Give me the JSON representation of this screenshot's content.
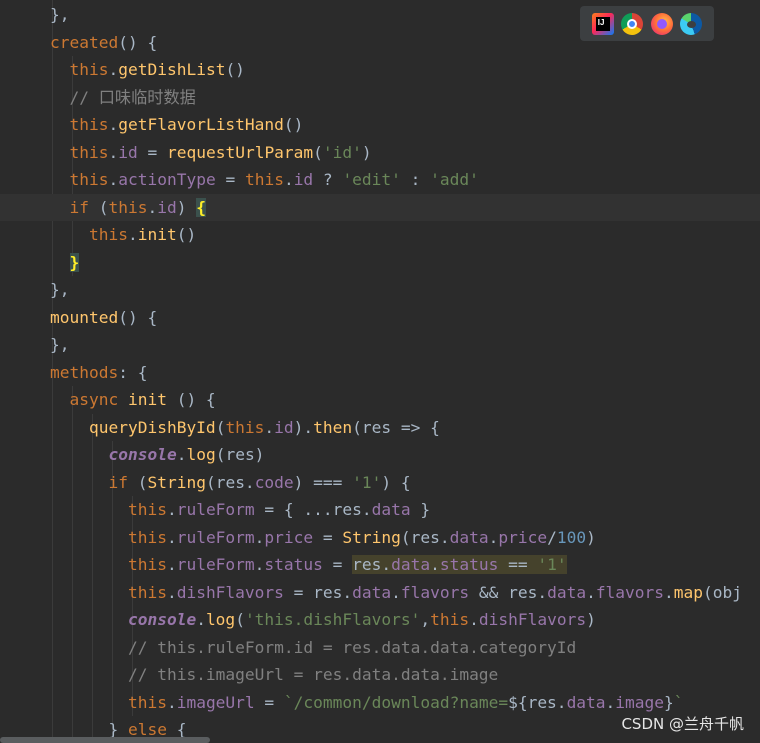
{
  "browser_bar": {
    "icons": [
      "intellij-icon",
      "chrome-icon",
      "firefox-icon",
      "edge-icon"
    ],
    "intellij_label": "IJ"
  },
  "watermark": "CSDN @兰舟千帆",
  "lines": [
    [
      {
        "t": "},",
        "c": "def"
      }
    ],
    [
      {
        "t": "created",
        "c": "kw"
      },
      {
        "t": "() {",
        "c": "def"
      }
    ],
    [
      {
        "t": "  this",
        "c": "this"
      },
      {
        "t": ".",
        "c": "def"
      },
      {
        "t": "getDishList",
        "c": "fn"
      },
      {
        "t": "()",
        "c": "def"
      }
    ],
    [
      {
        "t": "  // 口味临时数据",
        "c": "cmt"
      }
    ],
    [
      {
        "t": "  this",
        "c": "this"
      },
      {
        "t": ".",
        "c": "def"
      },
      {
        "t": "getFlavorListHand",
        "c": "fn"
      },
      {
        "t": "()",
        "c": "def"
      }
    ],
    [
      {
        "t": "  this",
        "c": "this"
      },
      {
        "t": ".",
        "c": "def"
      },
      {
        "t": "id",
        "c": "fld"
      },
      {
        "t": " = ",
        "c": "def"
      },
      {
        "t": "requestUrlParam",
        "c": "fn"
      },
      {
        "t": "(",
        "c": "def"
      },
      {
        "t": "'id'",
        "c": "str"
      },
      {
        "t": ")",
        "c": "def"
      }
    ],
    [
      {
        "t": "  this",
        "c": "this"
      },
      {
        "t": ".",
        "c": "def"
      },
      {
        "t": "actionType",
        "c": "fld"
      },
      {
        "t": " = ",
        "c": "def"
      },
      {
        "t": "this",
        "c": "this"
      },
      {
        "t": ".",
        "c": "def"
      },
      {
        "t": "id",
        "c": "fld"
      },
      {
        "t": " ? ",
        "c": "def"
      },
      {
        "t": "'edit'",
        "c": "str"
      },
      {
        "t": " : ",
        "c": "def"
      },
      {
        "t": "'add'",
        "c": "str"
      }
    ],
    [
      {
        "t": "  if",
        "c": "kw"
      },
      {
        "t": " (",
        "c": "def"
      },
      {
        "t": "this",
        "c": "this"
      },
      {
        "t": ".",
        "c": "def"
      },
      {
        "t": "id",
        "c": "fld"
      },
      {
        "t": ") ",
        "c": "def"
      },
      {
        "t": "{",
        "c": "brace"
      }
    ],
    [
      {
        "t": "    this",
        "c": "this"
      },
      {
        "t": ".",
        "c": "def"
      },
      {
        "t": "init",
        "c": "fn"
      },
      {
        "t": "()",
        "c": "def"
      }
    ],
    [
      {
        "t": "  ",
        "c": "def"
      },
      {
        "t": "}",
        "c": "brace"
      }
    ],
    [
      {
        "t": "},",
        "c": "def"
      }
    ],
    [
      {
        "t": "mounted",
        "c": "fn"
      },
      {
        "t": "() {",
        "c": "def"
      }
    ],
    [
      {
        "t": "},",
        "c": "def"
      }
    ],
    [
      {
        "t": "methods",
        "c": "kw"
      },
      {
        "t": ": {",
        "c": "def"
      }
    ],
    [
      {
        "t": "  async ",
        "c": "kw"
      },
      {
        "t": "init",
        "c": "fn"
      },
      {
        "t": " () {",
        "c": "def"
      }
    ],
    [
      {
        "t": "    queryDishById",
        "c": "fn"
      },
      {
        "t": "(",
        "c": "def"
      },
      {
        "t": "this",
        "c": "this"
      },
      {
        "t": ".",
        "c": "def"
      },
      {
        "t": "id",
        "c": "fld"
      },
      {
        "t": ").",
        "c": "def"
      },
      {
        "t": "then",
        "c": "fn"
      },
      {
        "t": "(res => {",
        "c": "def"
      }
    ],
    [
      {
        "t": "      console",
        "c": "con"
      },
      {
        "t": ".",
        "c": "def"
      },
      {
        "t": "log",
        "c": "fn"
      },
      {
        "t": "(res)",
        "c": "def"
      }
    ],
    [
      {
        "t": "      if",
        "c": "kw"
      },
      {
        "t": " (",
        "c": "def"
      },
      {
        "t": "String",
        "c": "fn"
      },
      {
        "t": "(res.",
        "c": "def"
      },
      {
        "t": "code",
        "c": "fld"
      },
      {
        "t": ") === ",
        "c": "def"
      },
      {
        "t": "'1'",
        "c": "str"
      },
      {
        "t": ") {",
        "c": "def"
      }
    ],
    [
      {
        "t": "        this",
        "c": "this"
      },
      {
        "t": ".",
        "c": "def"
      },
      {
        "t": "ruleForm",
        "c": "fld"
      },
      {
        "t": " = { ...res.",
        "c": "def"
      },
      {
        "t": "data",
        "c": "fld"
      },
      {
        "t": " }",
        "c": "def"
      }
    ],
    [
      {
        "t": "        this",
        "c": "this"
      },
      {
        "t": ".",
        "c": "def"
      },
      {
        "t": "ruleForm",
        "c": "fld"
      },
      {
        "t": ".",
        "c": "def"
      },
      {
        "t": "price",
        "c": "fld"
      },
      {
        "t": " = ",
        "c": "def"
      },
      {
        "t": "String",
        "c": "fn"
      },
      {
        "t": "(res.",
        "c": "def"
      },
      {
        "t": "data",
        "c": "fld"
      },
      {
        "t": ".",
        "c": "def"
      },
      {
        "t": "price",
        "c": "fld"
      },
      {
        "t": "/",
        "c": "def"
      },
      {
        "t": "100",
        "c": "num"
      },
      {
        "t": ")",
        "c": "def"
      }
    ],
    [
      {
        "t": "        this",
        "c": "this"
      },
      {
        "t": ".",
        "c": "def"
      },
      {
        "t": "ruleForm",
        "c": "fld"
      },
      {
        "t": ".",
        "c": "def"
      },
      {
        "t": "status",
        "c": "fld"
      },
      {
        "t": " = ",
        "c": "def"
      },
      {
        "t": "res.",
        "c": "hl"
      },
      {
        "t": "data",
        "c": "hlfld"
      },
      {
        "t": ".",
        "c": "hl"
      },
      {
        "t": "status",
        "c": "hlfld"
      },
      {
        "t": " == ",
        "c": "hl"
      },
      {
        "t": "'1'",
        "c": "hlstr"
      }
    ],
    [
      {
        "t": "        this",
        "c": "this"
      },
      {
        "t": ".",
        "c": "def"
      },
      {
        "t": "dishFlavors",
        "c": "fld"
      },
      {
        "t": " = res.",
        "c": "def"
      },
      {
        "t": "data",
        "c": "fld"
      },
      {
        "t": ".",
        "c": "def"
      },
      {
        "t": "flavors",
        "c": "fld"
      },
      {
        "t": " && res.",
        "c": "def"
      },
      {
        "t": "data",
        "c": "fld"
      },
      {
        "t": ".",
        "c": "def"
      },
      {
        "t": "flavors",
        "c": "fld"
      },
      {
        "t": ".",
        "c": "def"
      },
      {
        "t": "map",
        "c": "fn"
      },
      {
        "t": "(obj",
        "c": "def"
      }
    ],
    [
      {
        "t": "        console",
        "c": "con"
      },
      {
        "t": ".",
        "c": "def"
      },
      {
        "t": "log",
        "c": "fn"
      },
      {
        "t": "(",
        "c": "def"
      },
      {
        "t": "'this.dishFlavors'",
        "c": "str"
      },
      {
        "t": ",",
        "c": "def"
      },
      {
        "t": "this",
        "c": "this"
      },
      {
        "t": ".",
        "c": "def"
      },
      {
        "t": "dishFlavors",
        "c": "fld"
      },
      {
        "t": ")",
        "c": "def"
      }
    ],
    [
      {
        "t": "        // this.ruleForm.id = res.data.data.categoryId",
        "c": "cmt"
      }
    ],
    [
      {
        "t": "        // this.imageUrl = res.data.data.image",
        "c": "cmt"
      }
    ],
    [
      {
        "t": "        this",
        "c": "this"
      },
      {
        "t": ".",
        "c": "def"
      },
      {
        "t": "imageUrl",
        "c": "fld"
      },
      {
        "t": " = ",
        "c": "def"
      },
      {
        "t": "`/common/download?name=",
        "c": "str"
      },
      {
        "t": "${res.",
        "c": "tpl"
      },
      {
        "t": "data",
        "c": "fld"
      },
      {
        "t": ".",
        "c": "tpl"
      },
      {
        "t": "image",
        "c": "fld"
      },
      {
        "t": "}",
        "c": "tpl"
      },
      {
        "t": "`",
        "c": "str"
      }
    ],
    [
      {
        "t": "      } ",
        "c": "def"
      },
      {
        "t": "else",
        "c": "kw"
      },
      {
        "t": " {",
        "c": "def"
      }
    ]
  ],
  "current_line_index": 7
}
